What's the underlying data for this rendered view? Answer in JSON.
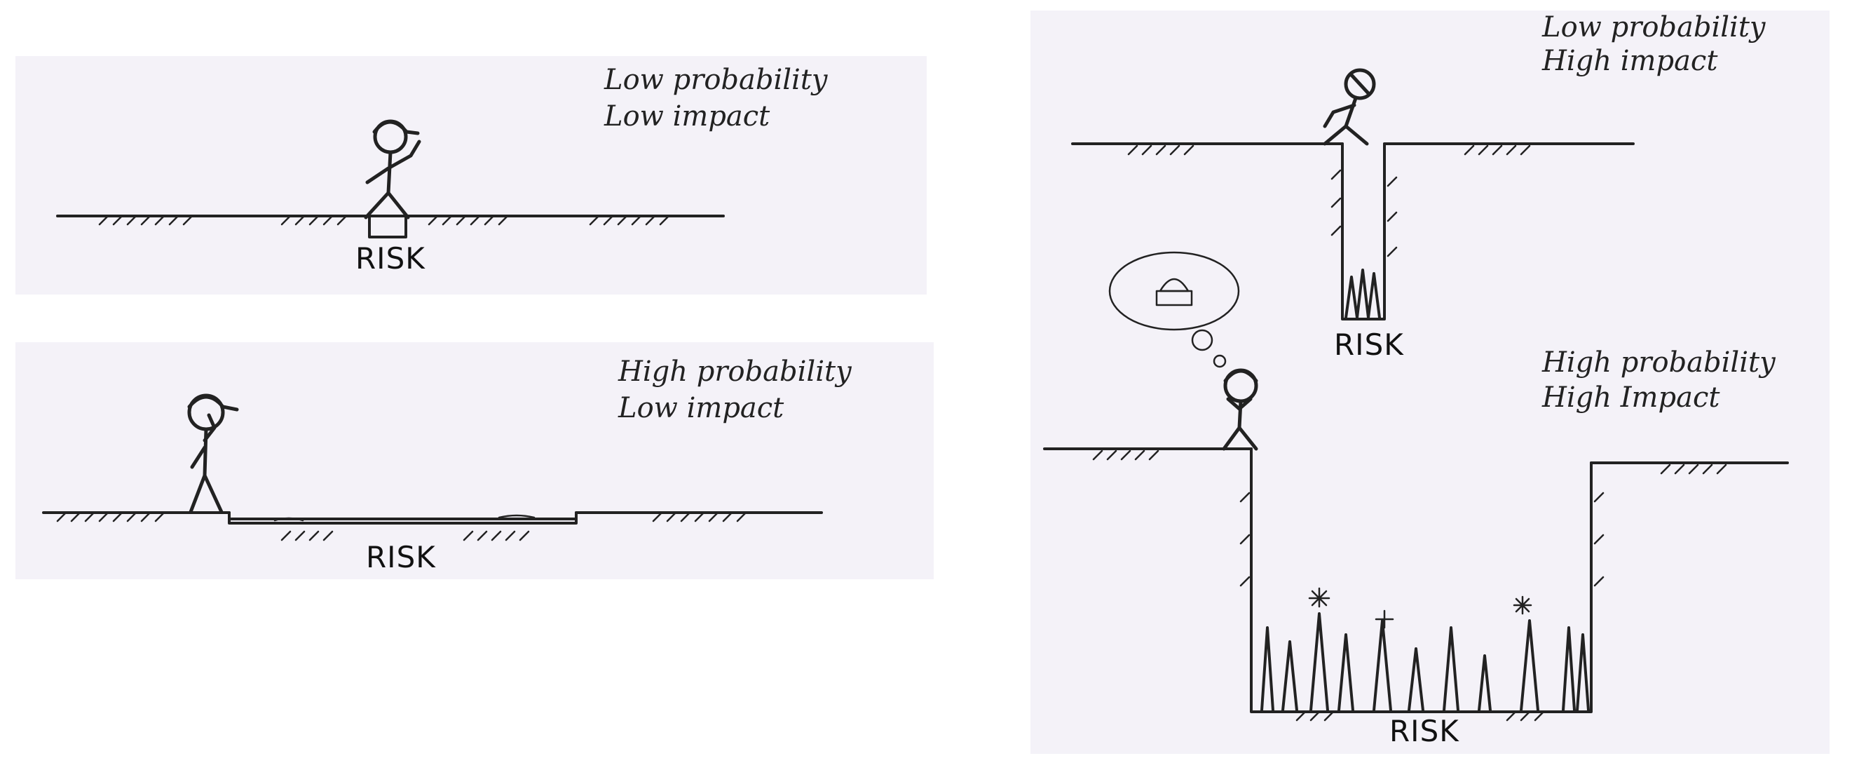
{
  "panels": {
    "low_low": {
      "caption_line1": "Low probability",
      "caption_line2": "Low impact",
      "risk_label": "RISK"
    },
    "high_low": {
      "caption_line1": "High probability",
      "caption_line2": "Low impact",
      "risk_label": "RISK"
    },
    "low_high": {
      "caption_line1": "Low probability",
      "caption_line2": "High impact",
      "risk_label": "RISK"
    },
    "high_high": {
      "caption_line1": "High probability",
      "caption_line2": "High Impact",
      "risk_label": "RISK"
    }
  },
  "colors": {
    "paper": "#f4f2f8",
    "ink": "#222222"
  }
}
